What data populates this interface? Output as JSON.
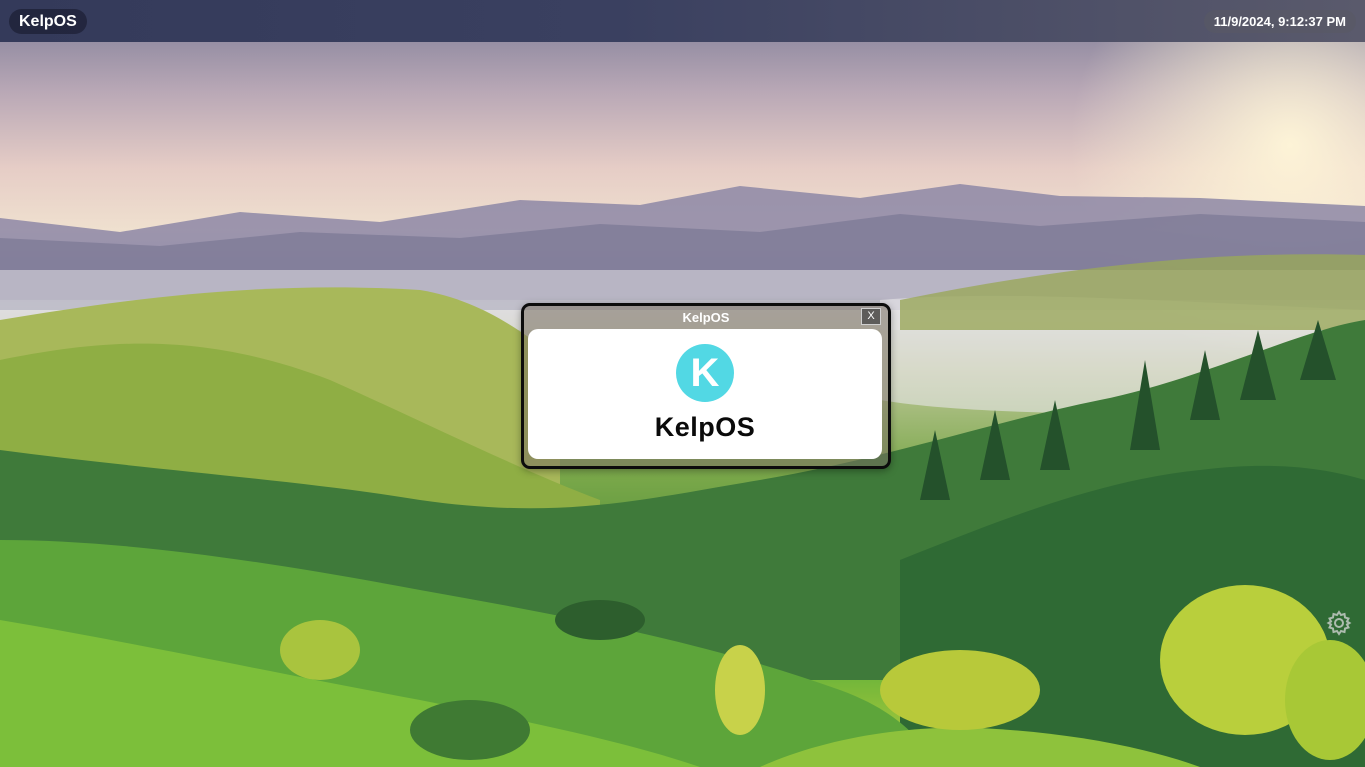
{
  "topbar": {
    "brand_label": "KelpOS",
    "clock": "11/9/2024, 9:12:37 PM"
  },
  "window": {
    "title": "KelpOS",
    "close_label": "X",
    "logo_letter": "K",
    "app_name": "KelpOS"
  },
  "colors": {
    "topbar": "#343a5a",
    "logo_accent": "#52d8e4",
    "window_border": "#0c0c0c"
  },
  "icons": {
    "settings": "gear-icon"
  }
}
